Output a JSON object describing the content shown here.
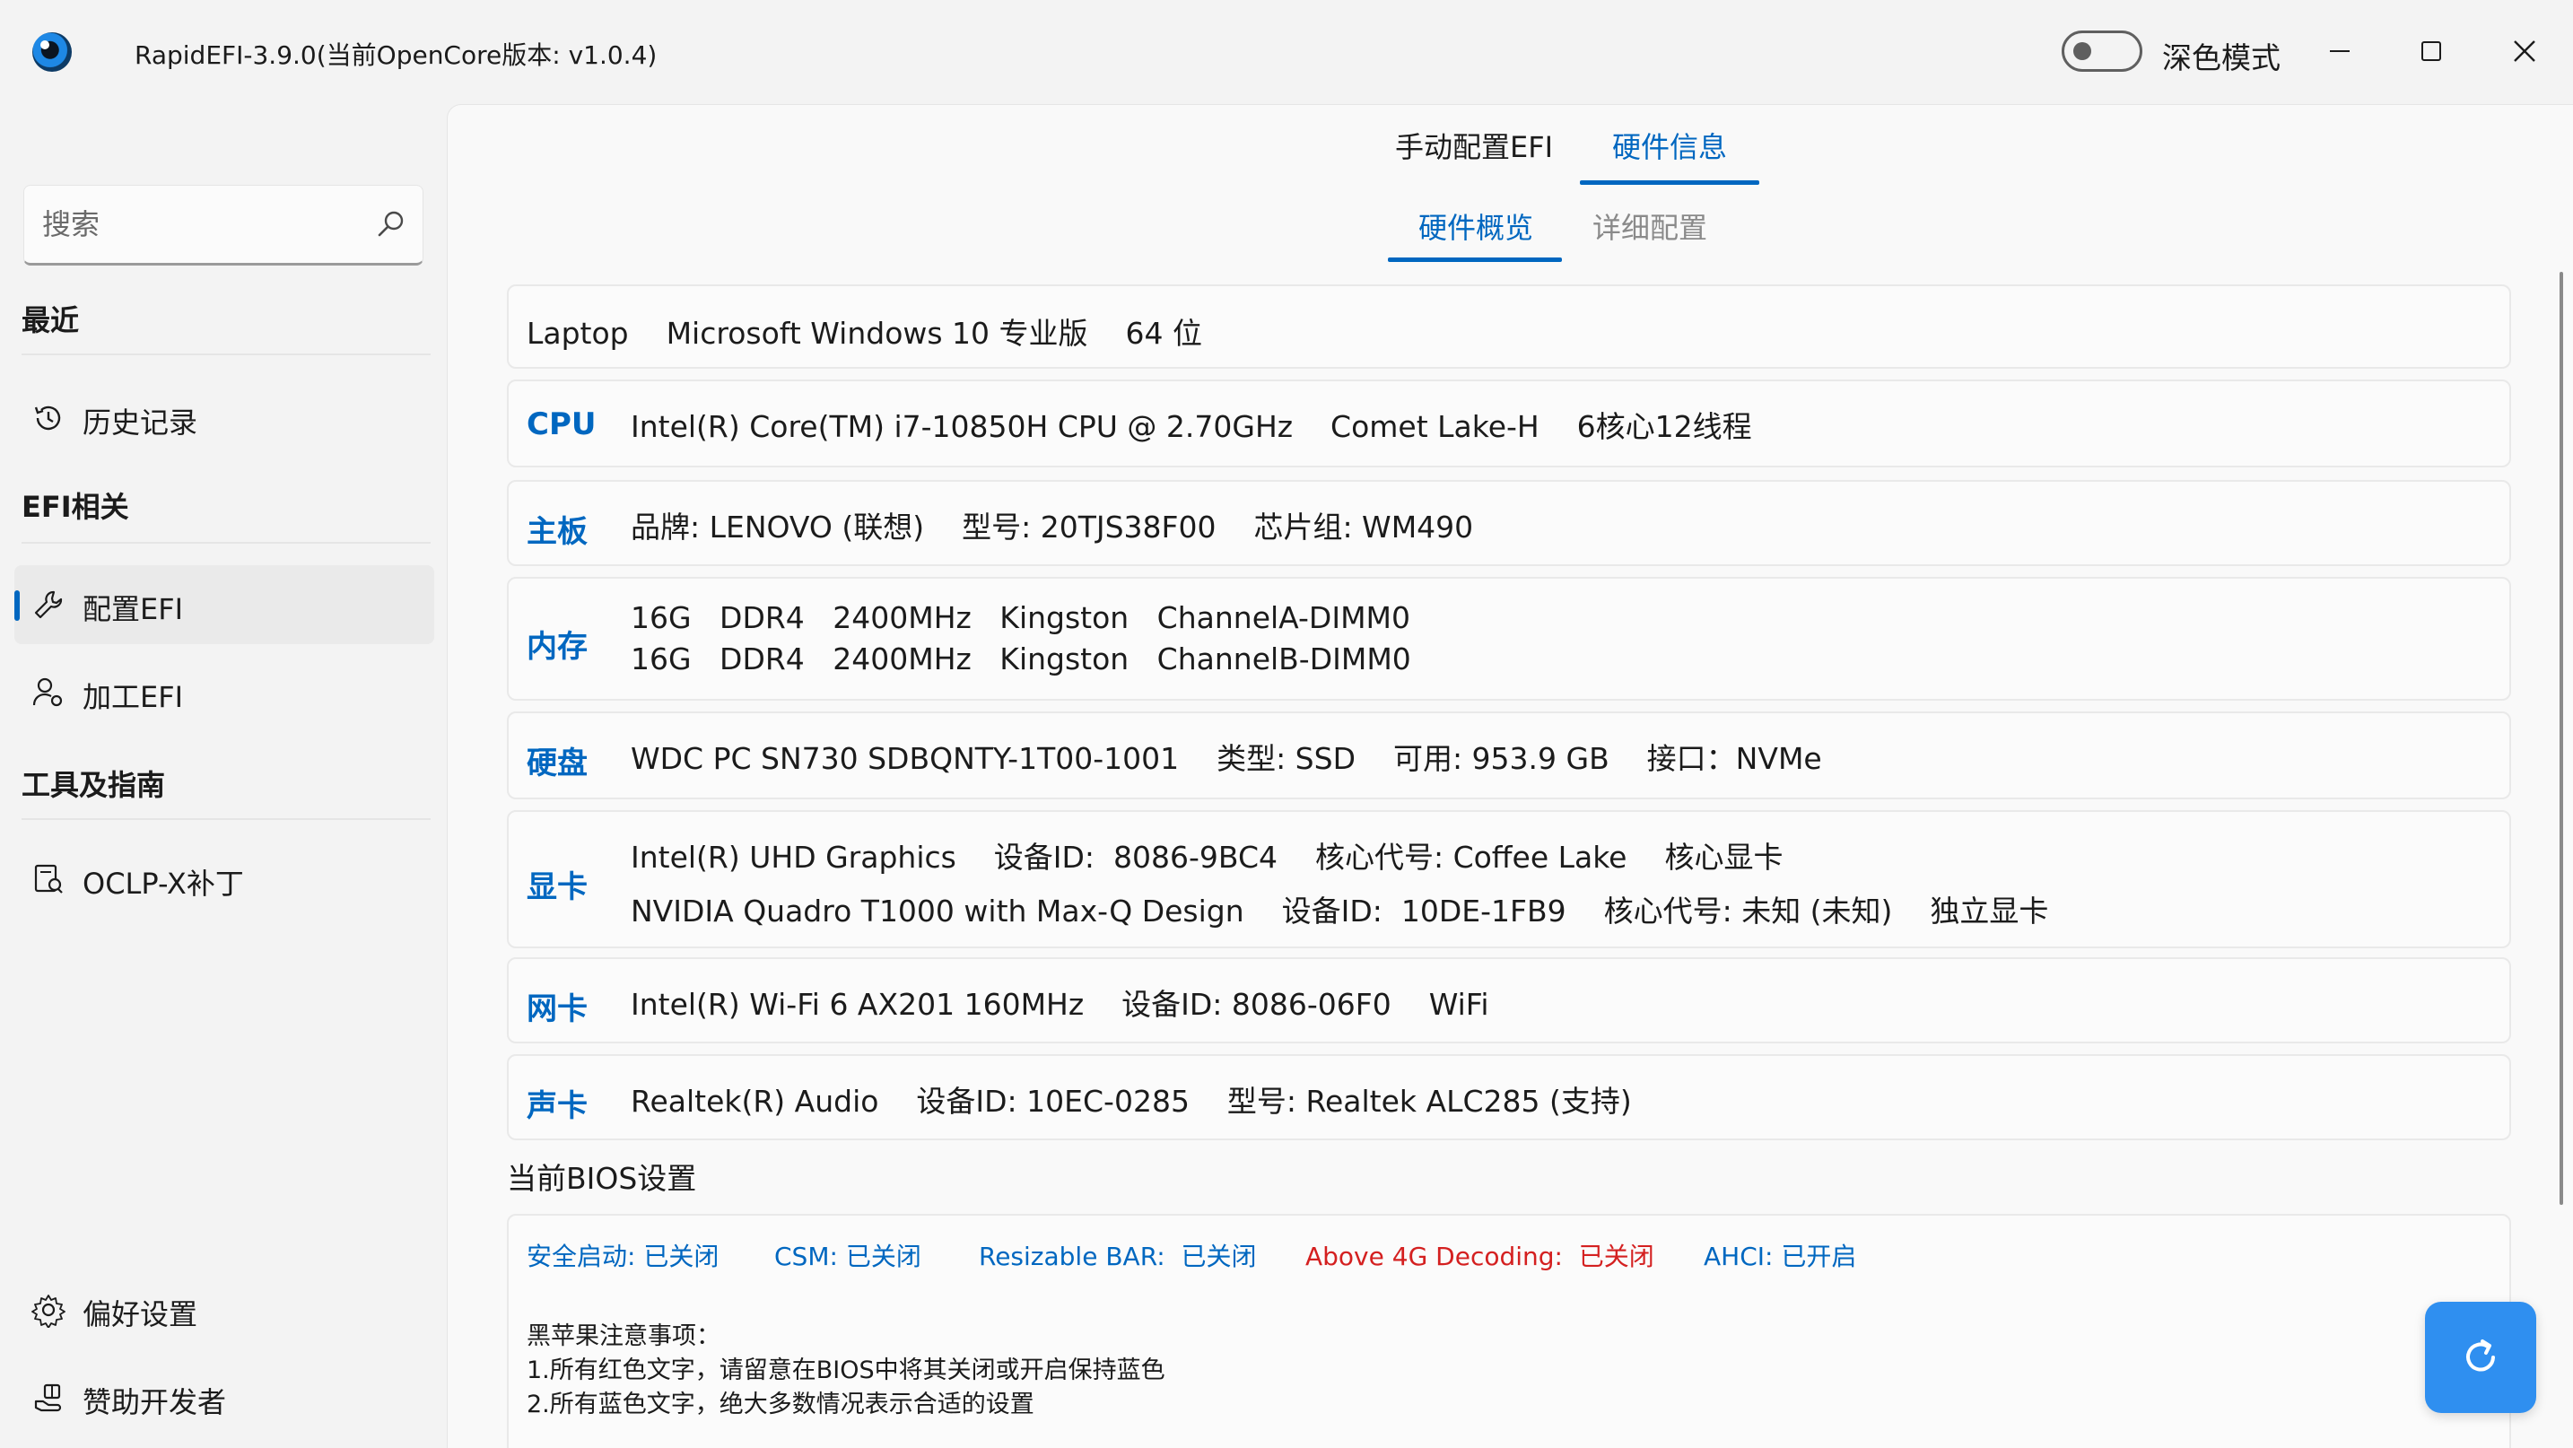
{
  "window": {
    "title": "RapidEFI-3.9.0(当前OpenCore版本: v1.0.4)",
    "theme_label": "深色模式",
    "theme_dark_enabled": false
  },
  "sidebar": {
    "search_placeholder": "搜索",
    "sections": [
      {
        "title": "最近",
        "items": [
          {
            "label": "历史记录",
            "icon": "history-icon"
          }
        ]
      },
      {
        "title": "EFI相关",
        "items": [
          {
            "label": "配置EFI",
            "icon": "wrench-icon",
            "active": true
          },
          {
            "label": "加工EFI",
            "icon": "user-gear-icon"
          }
        ]
      },
      {
        "title": "工具及指南",
        "items": [
          {
            "label": "OCLP-X补丁",
            "icon": "patch-icon"
          }
        ]
      }
    ],
    "footer": [
      {
        "label": "偏好设置",
        "icon": "gear-icon"
      },
      {
        "label": "赞助开发者",
        "icon": "gift-icon"
      }
    ]
  },
  "main": {
    "tabs": [
      {
        "label": "手动配置EFI",
        "active": false
      },
      {
        "label": "硬件信息",
        "active": true
      }
    ],
    "subtabs": [
      {
        "label": "硬件概览",
        "active": true
      },
      {
        "label": "详细配置",
        "active": false
      }
    ],
    "system_line": "Laptop    Microsoft Windows 10 专业版    64 位",
    "cards": {
      "cpu": {
        "title": "CPU",
        "lines": [
          "Intel(R) Core(TM) i7-10850H CPU @ 2.70GHz    Comet Lake-H    6核心12线程"
        ]
      },
      "board": {
        "title": "主板",
        "lines": [
          "品牌: LENOVO (联想)    型号: 20TJS38F00    芯片组: WM490"
        ]
      },
      "memory": {
        "title": "内存",
        "lines": [
          "16G   DDR4   2400MHz   Kingston   ChannelA-DIMM0",
          "16G   DDR4   2400MHz   Kingston   ChannelB-DIMM0"
        ]
      },
      "disk": {
        "title": "硬盘",
        "lines": [
          "WDC PC SN730 SDBQNTY-1T00-1001    类型: SSD    可用: 953.9 GB    接口：NVMe"
        ]
      },
      "gpu": {
        "title": "显卡",
        "lines": [
          "Intel(R) UHD Graphics    设备ID:  8086-9BC4    核心代号: Coffee Lake    核心显卡",
          "NVIDIA Quadro T1000 with Max-Q Design    设备ID:  10DE-1FB9    核心代号: 未知 (未知)    独立显卡"
        ]
      },
      "network": {
        "title": "网卡",
        "lines": [
          "Intel(R) Wi-Fi 6 AX201 160MHz    设备ID: 8086-06F0    WiFi"
        ]
      },
      "audio": {
        "title": "声卡",
        "lines": [
          "Realtek(R) Audio    设备ID: 10EC-0285    型号: Realtek ALC285 (支持)"
        ]
      }
    },
    "bios": {
      "heading": "当前BIOS设置",
      "items": [
        {
          "text": "安全启动: 已关闭",
          "status": "ok"
        },
        {
          "text": "CSM: 已关闭",
          "status": "ok"
        },
        {
          "text": "Resizable BAR:  已关闭",
          "status": "ok"
        },
        {
          "text": "Above 4G Decoding:  已关闭",
          "status": "warn"
        },
        {
          "text": "AHCI: 已开启",
          "status": "ok"
        }
      ],
      "notes": [
        "黑苹果注意事项：",
        "1.所有红色文字，请留意在BIOS中将其关闭或开启保持蓝色",
        "2.所有蓝色文字，绝大多数情况表示合适的设置"
      ]
    }
  },
  "colors": {
    "accent": "#0067c0",
    "warning": "#d42020",
    "refresh_button": "#2f8ff0"
  }
}
